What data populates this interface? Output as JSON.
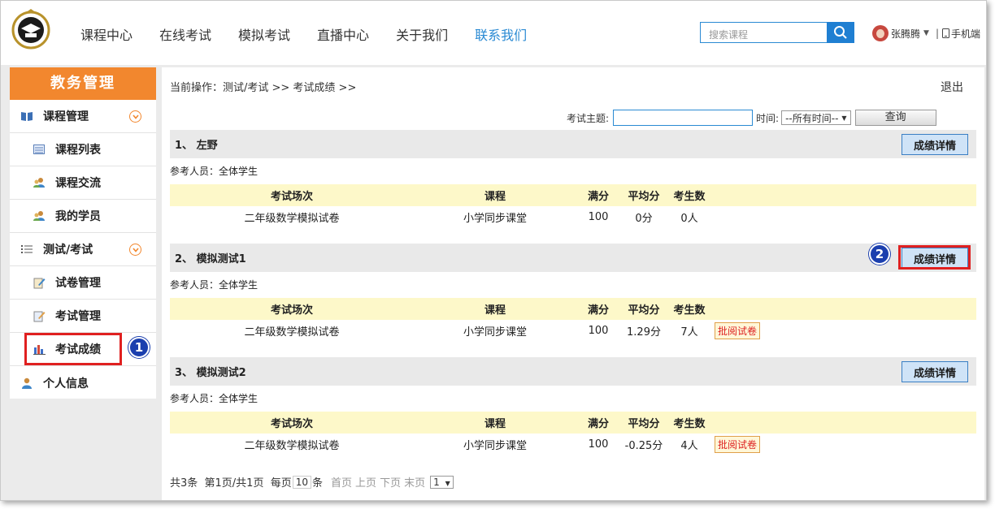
{
  "header": {
    "nav": [
      "课程中心",
      "在线考试",
      "模拟考试",
      "直播中心",
      "关于我们",
      "联系我们"
    ],
    "search_placeholder": "搜索课程",
    "user_name": "张腾腾",
    "mobile_label": "手机端"
  },
  "sidebar": {
    "title": "教务管理",
    "items": [
      {
        "label": "课程管理",
        "icon": "book-icon"
      },
      {
        "label": "课程列表",
        "icon": "list-icon"
      },
      {
        "label": "课程交流",
        "icon": "users-icon"
      },
      {
        "label": "我的学员",
        "icon": "users-icon"
      },
      {
        "label": "测试/考试",
        "icon": "bullet-list-icon"
      },
      {
        "label": "试卷管理",
        "icon": "paper-edit-icon"
      },
      {
        "label": "考试管理",
        "icon": "paper-edit-icon"
      },
      {
        "label": "考试成绩",
        "icon": "bar-chart-icon"
      },
      {
        "label": "个人信息",
        "icon": "user-icon"
      }
    ]
  },
  "main": {
    "breadcrumb": "当前操作：测试/考试 >> 考试成绩 >>",
    "logout": "退出",
    "filter": {
      "topic_label": "考试主题:",
      "time_label": "时间:",
      "time_value": "--所有时间--",
      "query_label": "查询"
    },
    "columns": [
      "考试场次",
      "课程",
      "满分",
      "平均分",
      "考生数"
    ],
    "detail_label": "成绩详情",
    "participants_label": "参考人员：全体学生",
    "exams": [
      {
        "title": "1、 左野",
        "row": [
          "二年级数学模拟试卷",
          "小学同步课堂",
          "100",
          "0分",
          "0人"
        ],
        "mark": ""
      },
      {
        "title": "2、 模拟测试1",
        "row": [
          "二年级数学模拟试卷",
          "小学同步课堂",
          "100",
          "1.29分",
          "7人"
        ],
        "mark": "批阅试卷"
      },
      {
        "title": "3、 模拟测试2",
        "row": [
          "二年级数学模拟试卷",
          "小学同步课堂",
          "100",
          "-0.25分",
          "4人"
        ],
        "mark": "批阅试卷"
      }
    ],
    "pager": {
      "summary": "共3条  第1页/共1页  每页",
      "per_page": "10",
      "per_page_unit": "条",
      "links": [
        "首页",
        "上页",
        "下页",
        "末页"
      ],
      "page": "1"
    }
  },
  "annotations": [
    "1",
    "2"
  ]
}
